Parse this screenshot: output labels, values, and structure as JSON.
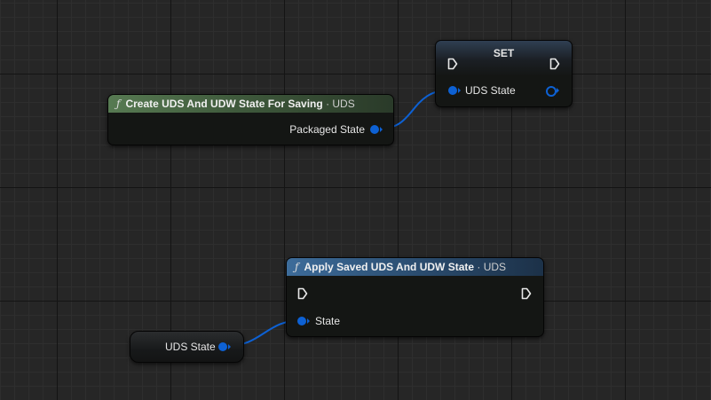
{
  "colors": {
    "grid_background": "#262626",
    "pin_struct": "#0d61d4",
    "function_header_green": "#577a52",
    "function_header_blue": "#3d6c9a"
  },
  "nodes": {
    "create_state": {
      "icon": "function-icon",
      "title": "Create UDS And UDW State For Saving",
      "subtitle": "· UDS",
      "output_pin": "Packaged State"
    },
    "set_node": {
      "title": "SET",
      "input_pin": "UDS State"
    },
    "apply_state": {
      "icon": "function-icon",
      "title": "Apply Saved UDS And UDW State",
      "subtitle": "· UDS",
      "input_pin": "State"
    },
    "get_variable": {
      "label": "UDS State"
    }
  }
}
